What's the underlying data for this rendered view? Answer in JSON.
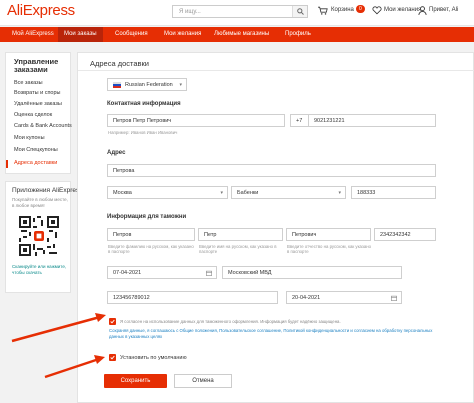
{
  "header": {
    "logo": "AliExpress",
    "search_placeholder": "Я ищу...",
    "cart_label": "Корзина",
    "cart_count": "0",
    "wishlist_label": "Мои желания",
    "user_label": "Привет, Ali"
  },
  "nav": {
    "items": [
      "Мой AliExpress",
      "Мои заказы",
      "Сообщения",
      "Мои желания",
      "Любимые магазины",
      "Профиль"
    ]
  },
  "sidebar": {
    "title": "Управление заказами",
    "items": [
      "Все заказы",
      "Возвраты и споры",
      "Удалённые заказы",
      "Оценка сделок",
      "Cards & Bank Accounts",
      "Мои купоны",
      "Мои Спецкупоны",
      "Адреса доставки"
    ]
  },
  "apps": {
    "title": "Приложения AliExpress",
    "description": "Покупайте в любом месте, в любое время!",
    "scan_text": "Сканируйте или нажмите, чтобы скачать"
  },
  "main": {
    "title": "Адреса доставки",
    "country": "Russian Federation",
    "contact_label": "Контактная информация",
    "full_name": "Петров Петр Петрович",
    "full_name_hint": "Например: Иванов Иван Иванович",
    "phone_code": "+7",
    "phone": "9021231221",
    "address_label": "Адрес",
    "street": "Петрова",
    "city": "Москва",
    "region": "Бабенки",
    "zip": "188333",
    "customs_label": "Информация для таможни",
    "last_name": "Петров",
    "first_name": "Петр",
    "middle_name": "Петрович",
    "passport_number": "2342342342",
    "hint_last_name": "Введите фамилию на русском, как указано в паспорте",
    "hint_first_name": "Введите имя на русском, как указано в паспорте",
    "hint_middle_name": "Введите отчество на русском, как указано в паспорте",
    "issue_date": "07-04-2021",
    "issued_by": "Московский МВД",
    "inn": "123456789012",
    "birth_date": "20-04-2021",
    "consent_text": "Я согласен на использование данных для таможенного оформления. Информация будет надёжно защищена.",
    "consent_links": "Сохраняя данные, я соглашаюсь с Общие положения, Пользовательское соглашение, Политикой конфиденциальности и согласием на обработку персональных данных в указанных целях",
    "default_label": "Установить по умолчанию",
    "save_label": "Сохранить",
    "cancel_label": "Отмена"
  },
  "colors": {
    "accent": "#e62e04",
    "nav_active": "#b9240a",
    "link": "#1a7fc1",
    "qr_accent": "#e62e04"
  },
  "icons": [
    "search-icon",
    "cart-icon",
    "heart-icon",
    "user-icon",
    "russian-flag-icon",
    "calendar-icon",
    "checkmark-icon",
    "qr-code",
    "arrow-pointer"
  ]
}
